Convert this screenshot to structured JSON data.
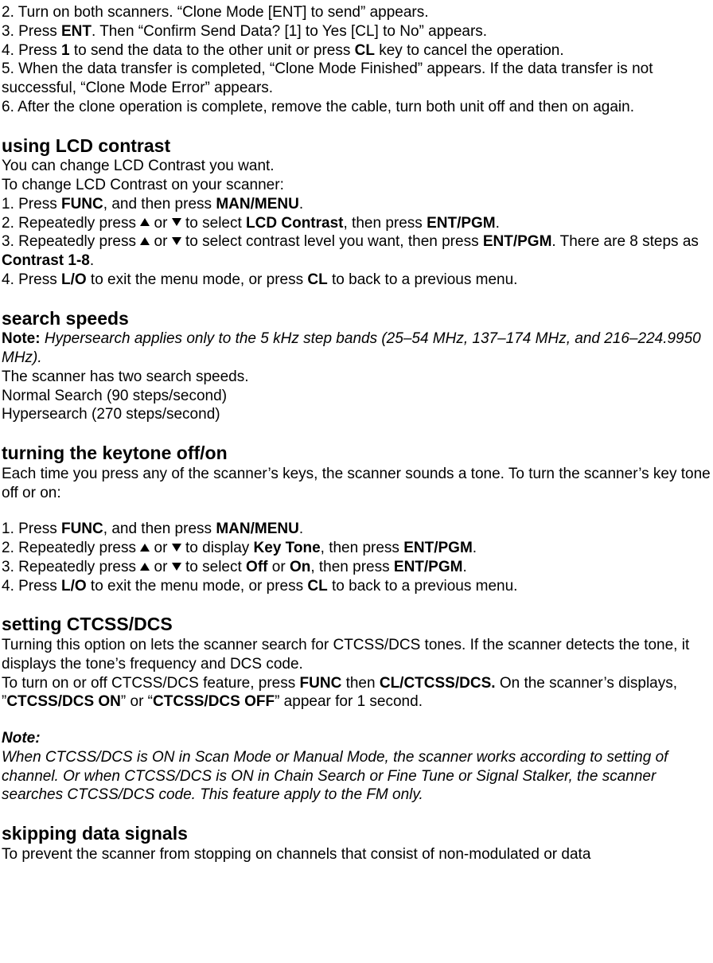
{
  "top_steps": {
    "s2": "2. Turn on both scanners. “Clone Mode [ENT] to send” appears.",
    "s3a": "3. Press ",
    "s3b": "ENT",
    "s3c": ". Then “Confirm Send Data? [1] to Yes [CL] to No” appears.",
    "s4a": "4. Press ",
    "s4b": "1",
    "s4c": " to send the data to the other unit or press ",
    "s4d": "CL",
    "s4e": " key to cancel the operation.",
    "s5": "5. When the data transfer is completed, “Clone Mode Finished” appears. If the data transfer is not successful, “Clone Mode Error” appears.",
    "s6": "6. After the clone operation is complete, remove the cable, turn both unit off and then on again."
  },
  "lcd": {
    "heading": "using LCD contrast",
    "l1": "You can change LCD Contrast you want.",
    "l2": "To change LCD Contrast on your scanner:",
    "s1a": "1. Press ",
    "s1b": "FUNC",
    "s1c": ", and then press ",
    "s1d": "MAN/MENU",
    "s1e": ".",
    "s2a": "2. Repeatedly press  ",
    "s2b": " or  ",
    "s2c": "  to select ",
    "s2d": "LCD Contrast",
    "s2e": ", then press ",
    "s2f": "ENT/PGM",
    "s2g": ".",
    "s3a": "3. Repeatedly press  ",
    "s3b": " or  ",
    "s3c": "  to select contrast level you want, then press ",
    "s3d": "ENT/PGM",
    "s3e": ". There are 8 steps as ",
    "s3f": "Contrast 1-8",
    "s3g": ".",
    "s4a": "4. Press ",
    "s4b": "L/O",
    "s4c": " to exit the menu mode, or press ",
    "s4d": "CL",
    "s4e": " to back to a previous menu."
  },
  "search": {
    "heading": "search speeds",
    "note_label": "Note:",
    "note_text": " Hypersearch applies only to the 5 kHz step bands (25–54 MHz, 137–174 MHz, and 216–224.9950 MHz).",
    "l1": "The scanner has two search speeds.",
    "l2": "Normal Search (90 steps/second)",
    "l3": "Hypersearch (270 steps/second)"
  },
  "keytone": {
    "heading": "turning the keytone off/on",
    "intro": "Each time you press any of the scanner’s keys, the scanner sounds a tone. To turn the scanner’s key tone off or on:",
    "s1a": "1. Press ",
    "s1b": "FUNC",
    "s1c": ", and then press ",
    "s1d": "MAN/MENU",
    "s1e": ".",
    "s2a": "2. Repeatedly press  ",
    "s2b": " or  ",
    "s2c": "  to display ",
    "s2d": "Key Tone",
    "s2e": ", then press ",
    "s2f": "ENT/PGM",
    "s2g": ".",
    "s3a": "3. Repeatedly press  ",
    "s3b": " or  ",
    "s3c": "  to select ",
    "s3d": "Off",
    "s3e": " or ",
    "s3f": "On",
    "s3g": ", then press ",
    "s3h": "ENT/PGM",
    "s3i": ".",
    "s4a": "4. Press ",
    "s4b": "L/O",
    "s4c": " to exit the menu mode, or press ",
    "s4d": "CL",
    "s4e": " to back to a previous menu."
  },
  "ctcss": {
    "heading": "setting CTCSS/DCS",
    "l1": "Turning this option on lets the scanner search for CTCSS/DCS tones. If the scanner detects the tone, it displays the tone’s frequency and DCS code.",
    "l2a": "To turn on or off CTCSS/DCS feature, press ",
    "l2b": "FUNC",
    "l2c": " then ",
    "l2d": "CL/CTCSS/DCS.",
    "l2e": " On the   scanner’s displays, ”",
    "l2f": "CTCSS/DCS ON",
    "l2g": "” or “",
    "l2h": "CTCSS/DCS OFF",
    "l2i": "” appear for 1 second.",
    "note_label": "Note:",
    "note_text": "When CTCSS/DCS is ON in Scan Mode or Manual Mode, the scanner works according to setting of channel. Or when CTCSS/DCS is ON in Chain Search or Fine Tune or Signal Stalker, the scanner searches CTCSS/DCS code. This feature apply to the FM only."
  },
  "skip": {
    "heading": "skipping data signals",
    "l1": "To prevent the scanner from stopping on channels that consist of non-modulated or data"
  }
}
